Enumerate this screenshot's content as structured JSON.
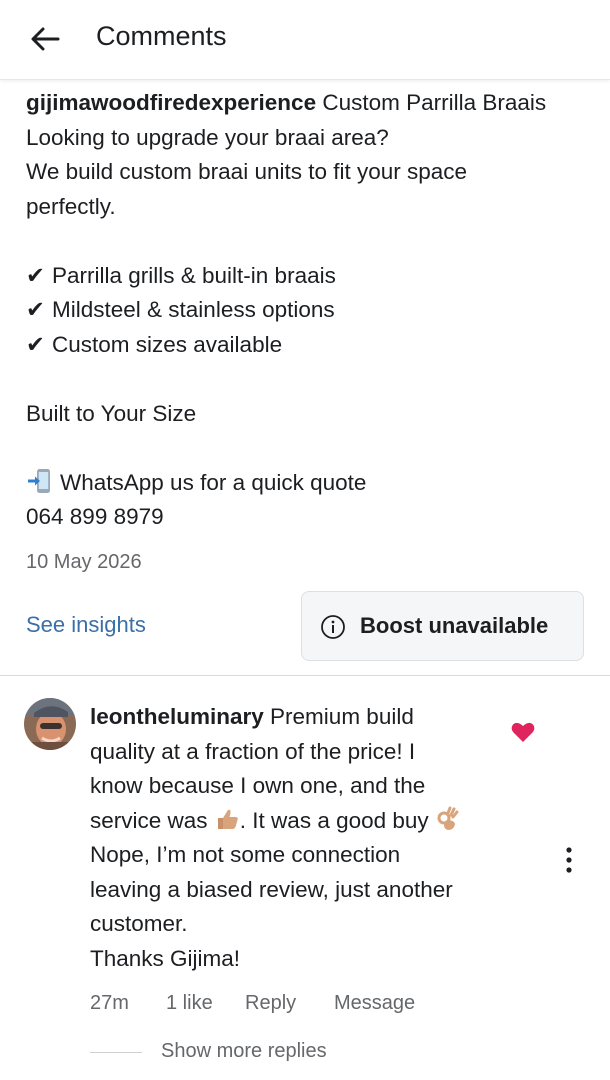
{
  "header": {
    "title": "Comments",
    "back_icon": "arrow-left-icon"
  },
  "post": {
    "owner": "gijimawoodfiredexperience",
    "title_text": " Custom Parrilla Braais",
    "lines": [
      "Looking to upgrade your braai area?",
      "We build custom braai units to fit your space",
      "perfectly."
    ],
    "check_mark": "✔",
    "bullets": [
      "Parrilla grills & built-in braais",
      "Mildsteel & stainless options",
      "Custom sizes available"
    ],
    "tagline": "Built to Your Size",
    "whatsapp_text": "WhatsApp us for a quick quote",
    "phone": "064 899 8979",
    "date": "10 May 2026"
  },
  "actions": {
    "insights_label": "See insights",
    "boost_label": "Boost unavailable"
  },
  "comment": {
    "username": "leontheluminary",
    "line1_text": " Premium build",
    "line2": "quality at a fraction of the price! I",
    "line3": "know because I own one, and the",
    "line4_a": "service was ",
    "line4_b": ". It was a good buy ",
    "line5": "Nope, I’m not some connection",
    "line6": "leaving a biased review, just another",
    "line7": "customer.",
    "line8": "Thanks Gijima!",
    "time": "27m",
    "likes": "1 like",
    "reply_label": "Reply",
    "message_label": "Message",
    "liked": true,
    "heart_color": "#e0245e"
  },
  "show_more_replies": "Show more replies",
  "colors": {
    "link": "#3b6fa8",
    "muted": "#65676b",
    "heart": "#e0245e"
  }
}
